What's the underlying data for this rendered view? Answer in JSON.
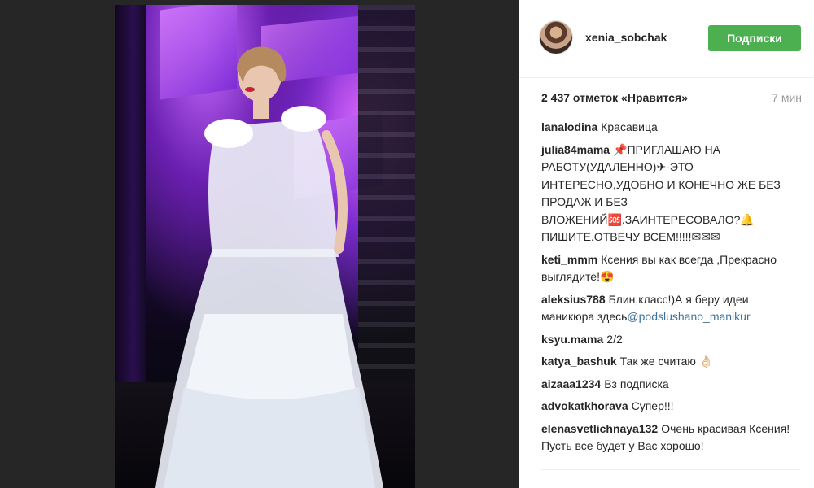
{
  "post": {
    "username": "xenia_sobchak",
    "follow_label": "Подписки",
    "likes": "2 437 отметок «Нравится»",
    "time": "7 мин"
  },
  "comments": [
    {
      "author": "lanalodina",
      "text": "Красавица"
    },
    {
      "author": "julia84mama",
      "text": "📌ПРИГЛАШАЮ НА РАБОТУ(УДАЛЕННО)✈-ЭТО ИНТЕРЕСНО,УДОБНО И КОНЕЧНО ЖЕ БЕЗ ПРОДАЖ И БЕЗ ВЛОЖЕНИЙ🆘.ЗАИНТЕРЕСОВАЛО?🔔 ПИШИТЕ.ОТВЕЧУ ВСЕМ!!!!!✉✉✉"
    },
    {
      "author": "keti_mmm",
      "text": "Ксения вы как всегда ,Прекрасно выглядите!😍"
    },
    {
      "author": "aleksius788",
      "text": "Блин,класс!)А я беру идеи маникюра здесь",
      "mention": "@podslushano_manikur"
    },
    {
      "author": "ksyu.mama",
      "text": "2/2"
    },
    {
      "author": "katya_bashuk",
      "text": "Так же считаю 👌🏻"
    },
    {
      "author": "aizaaa1234",
      "text": "Вз подписка"
    },
    {
      "author": "advokatkhorava",
      "text": "Супер!!!"
    },
    {
      "author": "elenasvetlichnaya132",
      "text": "Очень красивая Ксения!Пусть все будет у Вас хорошо!"
    }
  ],
  "icons": {
    "avatar": "profile-avatar",
    "photo": "post-photo"
  },
  "colors": {
    "follow_button": "#4caf50",
    "mention": "#3f729b",
    "media_bg": "#262626",
    "muted": "#999999"
  }
}
